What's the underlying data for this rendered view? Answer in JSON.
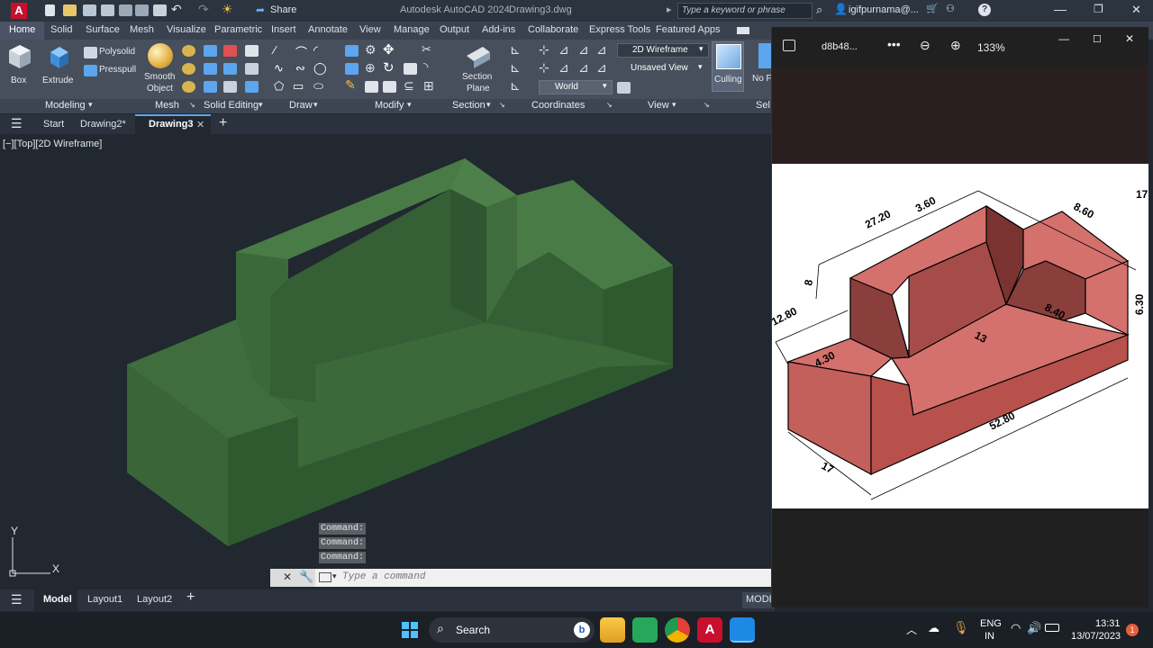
{
  "titlebar": {
    "app_title": "Autodesk AutoCAD 2024",
    "doc_title": "Drawing3.dwg",
    "share": "Share",
    "search_placeholder": "Type a keyword or phrase",
    "user": "igifpurnama@..."
  },
  "ribbon_tabs": [
    "Home",
    "Solid",
    "Surface",
    "Mesh",
    "Visualize",
    "Parametric",
    "Insert",
    "Annotate",
    "View",
    "Manage",
    "Output",
    "Add-ins",
    "Collaborate",
    "Express Tools",
    "Featured Apps"
  ],
  "ribbon": {
    "box": "Box",
    "extrude": "Extrude",
    "polysolid": "Polysolid",
    "presspull": "Presspull",
    "smooth": "Smooth",
    "object": "Object",
    "section": "Section",
    "plane": "Plane",
    "visual_style": "2D Wireframe",
    "view": "Unsaved View",
    "ucs": "World",
    "culling": "Culling",
    "no_f": "No F"
  },
  "panels": {
    "modeling": "Modeling",
    "mesh": "Mesh",
    "solid_editing": "Solid Editing",
    "draw": "Draw",
    "modify": "Modify",
    "section": "Section",
    "coordinates": "Coordinates",
    "view": "View",
    "sel": "Sel"
  },
  "file_tabs": {
    "start": "Start",
    "drawing2": "Drawing2*",
    "drawing3": "Drawing3"
  },
  "viewport": {
    "label": "[−][Top][2D Wireframe]",
    "axis_y": "Y",
    "axis_x": "X"
  },
  "command": {
    "history": [
      "Command:",
      "Command:",
      "Command:"
    ],
    "placeholder": "Type a command"
  },
  "bottom": {
    "model": "Model",
    "layout1": "Layout1",
    "layout2": "Layout2",
    "mode": "MODE"
  },
  "viewer": {
    "filename": "d8b48...",
    "zoom": "133%"
  },
  "dims": {
    "d1": "27.20",
    "d2": "3.60",
    "d3": "8.60",
    "d4": "8",
    "d5": "12.80",
    "d6": "4.30",
    "d7": "13",
    "d8": "8.40",
    "d9": "52.80",
    "d10": "17",
    "d11": "17",
    "d12": "6.30"
  },
  "taskbar": {
    "search": "Search",
    "lang1": "ENG",
    "lang2": "IN",
    "time": "13:31",
    "date": "13/07/2023",
    "notif": "1"
  },
  "colors": {
    "solid": "#3d6b3c",
    "part": "#d4716d",
    "accent": "#0d5fa8",
    "autocad": "#c8102e"
  }
}
